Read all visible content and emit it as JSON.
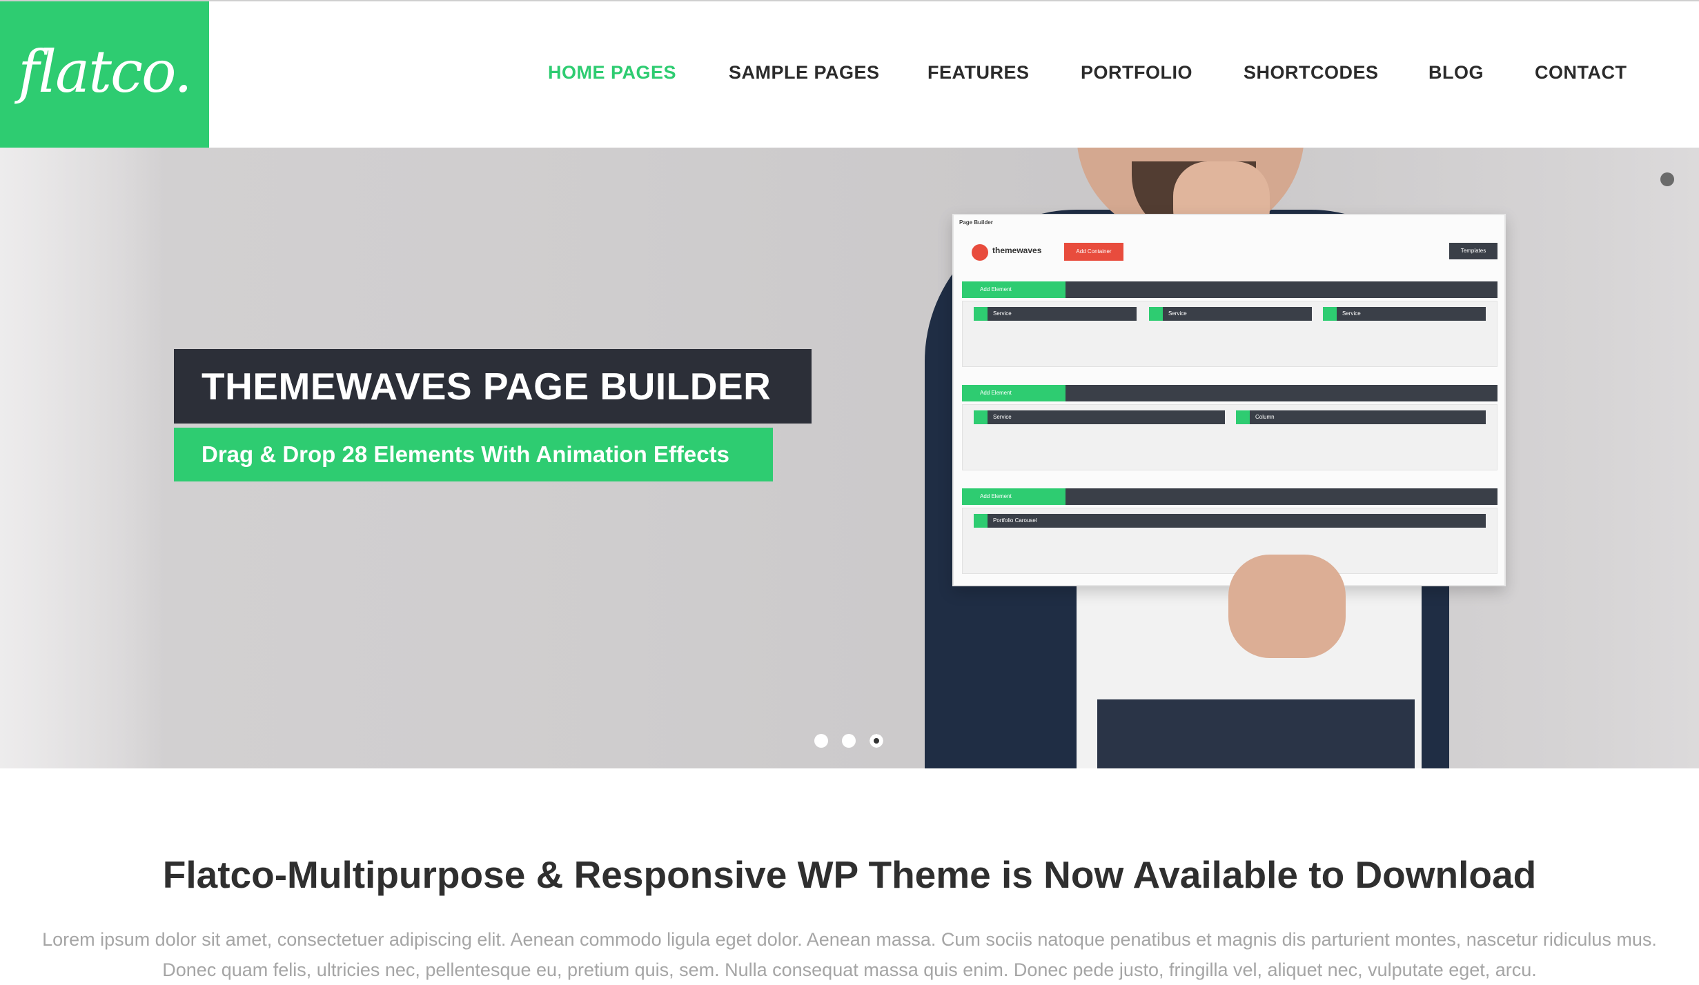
{
  "brand": {
    "logo_text": "flatco.",
    "accent": "#2ecc71",
    "dark": "#2c2f38"
  },
  "nav": {
    "items": [
      {
        "label": "HOME PAGES",
        "active": true
      },
      {
        "label": "SAMPLE PAGES",
        "active": false
      },
      {
        "label": "FEATURES",
        "active": false
      },
      {
        "label": "PORTFOLIO",
        "active": false
      },
      {
        "label": "SHORTCODES",
        "active": false
      },
      {
        "label": "BLOG",
        "active": false
      },
      {
        "label": "CONTACT",
        "active": false
      }
    ]
  },
  "slider": {
    "title": "THEMEWAVES PAGE BUILDER",
    "subtitle": "Drag & Drop 28 Elements With Animation Effects",
    "dots": 3,
    "active_dot": 3,
    "mockup": {
      "header": "Page Builder",
      "brand": "themewaves",
      "add_container": "Add Container",
      "templates": "Templates",
      "add_element": "Add Element",
      "elements": [
        "Service",
        "Service",
        "Service",
        "Service",
        "Column",
        "Portfolio Carousel"
      ]
    }
  },
  "intro": {
    "title": "Flatco-Multipurpose & Responsive WP Theme is Now Available to Download",
    "line1": "Lorem ipsum dolor sit amet, consectetuer adipiscing elit. Aenean commodo ligula eget dolor. Aenean massa. Cum sociis natoque penatibus et magnis dis parturient montes, nascetur ridiculus mus.",
    "line2": "Donec quam felis, ultricies nec, pellentesque eu, pretium quis, sem. Nulla consequat massa quis enim. Donec pede justo, fringilla vel, aliquet nec, vulputate eget, arcu."
  }
}
